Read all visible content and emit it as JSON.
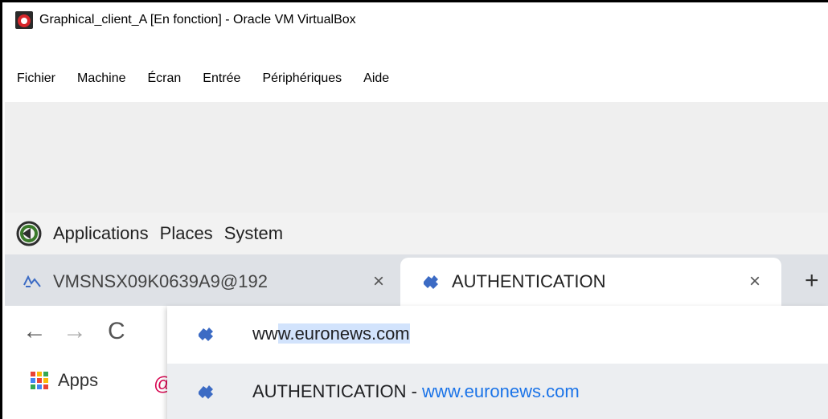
{
  "window": {
    "title": "Graphical_client_A [En fonction] - Oracle VM VirtualBox",
    "menu": [
      "Fichier",
      "Machine",
      "Écran",
      "Entrée",
      "Périphériques",
      "Aide"
    ]
  },
  "gnome_panel": {
    "items": [
      "Applications",
      "Places",
      "System"
    ]
  },
  "tabs": [
    {
      "title": "VMSNSX09K0639A9@192",
      "icon": "network-icon",
      "active": false
    },
    {
      "title": "AUTHENTICATION",
      "icon": "puzzle-icon",
      "active": true
    }
  ],
  "toolbar": {
    "apps_label": "Apps"
  },
  "omnibox": {
    "typed_prefix": "ww",
    "autocomplete": "w.euronews.com",
    "suggestion": {
      "title": "AUTHENTICATION",
      "separator": " - ",
      "url_prefix": "ww",
      "url_rest": "w.euronews.com"
    }
  },
  "colors": {
    "tab_strip": "#dee1e6",
    "highlight": "#d2e3fc",
    "url_blue": "#1a73e8",
    "favicon_blue": "#3c6bc4"
  }
}
